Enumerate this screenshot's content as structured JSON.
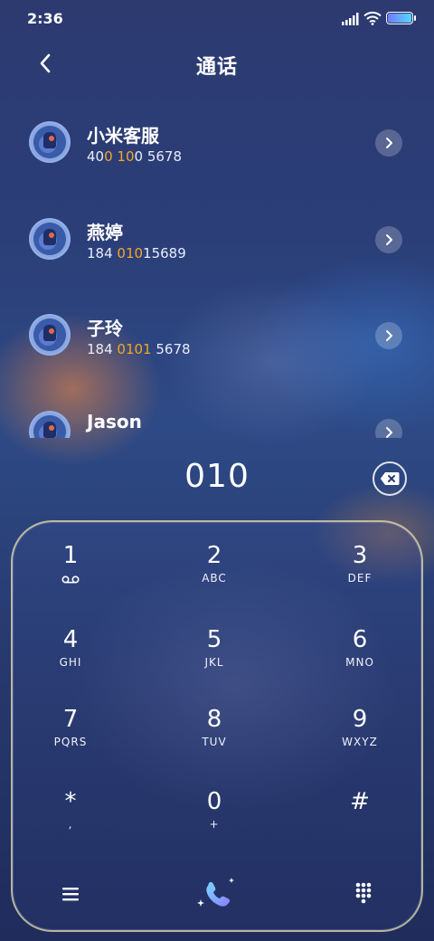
{
  "status_bar": {
    "time": "2:36",
    "battery_level": 1.0
  },
  "header": {
    "title": "通话",
    "back_icon": "chevron-left-icon"
  },
  "contacts": [
    {
      "name": "小米客服",
      "number_parts": [
        {
          "t": "40",
          "h": false
        },
        {
          "t": "0",
          "h": true
        },
        {
          "t": " ",
          "h": false
        },
        {
          "t": "10",
          "h": true
        },
        {
          "t": "0 5678",
          "h": false
        }
      ]
    },
    {
      "name": "燕婷",
      "number_parts": [
        {
          "t": "184 ",
          "h": false
        },
        {
          "t": "010",
          "h": true
        },
        {
          "t": "15689",
          "h": false
        }
      ]
    },
    {
      "name": "子玲",
      "number_parts": [
        {
          "t": "184 ",
          "h": false
        },
        {
          "t": "0101",
          "h": true
        },
        {
          "t": " 5678",
          "h": false
        }
      ]
    },
    {
      "name": "Jason",
      "number_parts": []
    }
  ],
  "dialer": {
    "dialed": "010",
    "keys": [
      {
        "digit": "1",
        "letters": "",
        "icon": "voicemail-icon"
      },
      {
        "digit": "2",
        "letters": "ABC"
      },
      {
        "digit": "3",
        "letters": "DEF"
      },
      {
        "digit": "4",
        "letters": "GHI"
      },
      {
        "digit": "5",
        "letters": "JKL"
      },
      {
        "digit": "6",
        "letters": "MNO"
      },
      {
        "digit": "7",
        "letters": "PQRS"
      },
      {
        "digit": "8",
        "letters": "TUV"
      },
      {
        "digit": "9",
        "letters": "WXYZ"
      },
      {
        "digit": "*",
        "letters": ","
      },
      {
        "digit": "0",
        "letters": "+"
      },
      {
        "digit": "#",
        "letters": ""
      }
    ]
  },
  "colors": {
    "highlight": "#f5a623",
    "panel_border": "#ebe1aa",
    "call_icon_gradient": [
      "#7ad7ff",
      "#8a7cff"
    ]
  }
}
